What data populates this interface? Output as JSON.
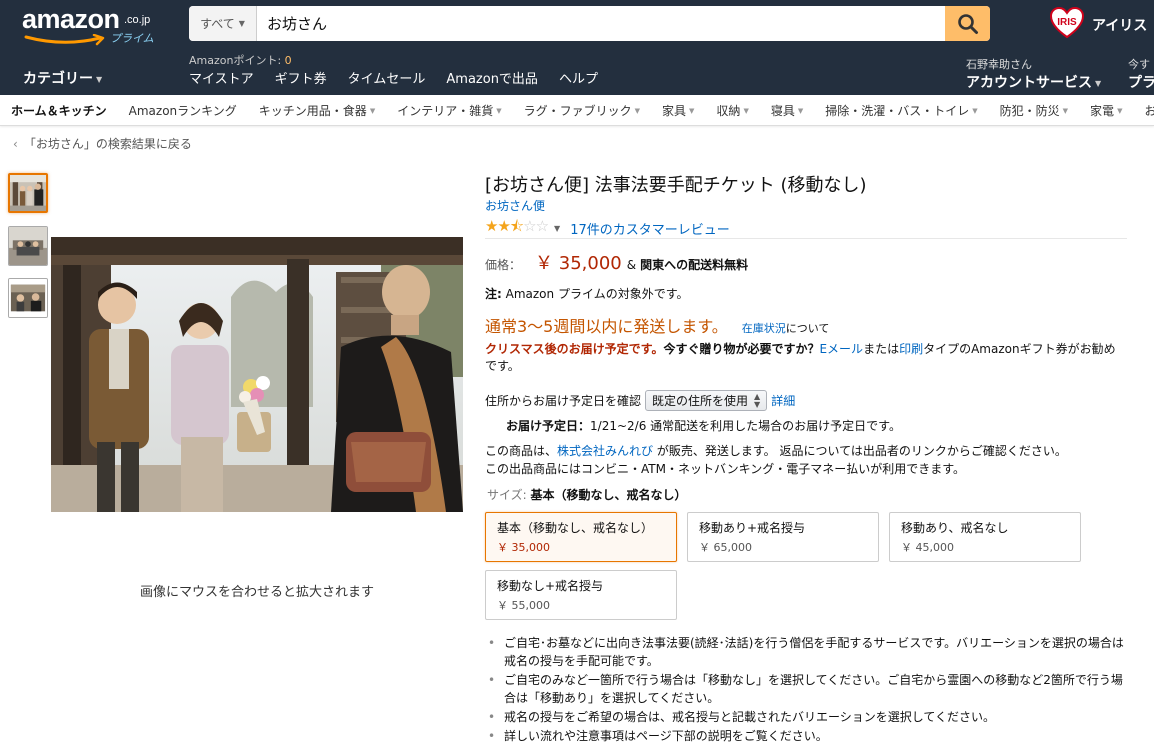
{
  "header": {
    "logo_text": "amazon",
    "logo_tld": ".co.jp",
    "logo_prime": "プライム",
    "search_dept": "すべて",
    "search_query": "お坊さん",
    "promo_text": "アイリス",
    "promo_badge": "IRIS",
    "category_label": "カテゴリー",
    "points_label": "Amazonポイント: ",
    "points_value": "0",
    "nav_links": [
      "マイストア",
      "ギフト券",
      "タイムセール",
      "Amazonで出品",
      "ヘルプ"
    ],
    "account_hello": "石野幸助さん",
    "account_label": "アカウントサービス",
    "prime_hello": "今す",
    "prime_label": "プラ"
  },
  "subnav": {
    "home": "ホーム＆キッチン",
    "items": [
      "Amazonランキング",
      "キッチン用品・食器",
      "インテリア・雑貨",
      "ラグ・ファブリック",
      "家具",
      "収納",
      "寝具",
      "掃除・洗濯・バス・トイレ",
      "防犯・防災",
      "家電",
      "お"
    ]
  },
  "back_link": "「お坊さん」の検索結果に戻る",
  "zoom_hint": "画像にマウスを合わせると拡大されます",
  "product": {
    "title": "[お坊さん便] 法事法要手配チケット (移動なし)",
    "brand": "お坊さん便",
    "rating": 2.5,
    "reviews": "17件のカスタマーレビュー",
    "price_label": "価格：",
    "price": "￥ 35,000",
    "price_amp": "&",
    "shipping": "関東への配送料無料",
    "prime_note_key": "注:",
    "prime_note": " Amazon プライムの対象外です。",
    "availability": "通常3～5週間以内に発送します。",
    "stock_link": "在庫状況",
    "stock_after": "について",
    "xmas_red": "クリスマス後のお届け予定です。",
    "xmas_bold": "今すぐ贈り物が必要ですか？",
    "xmas_link1": "Eメール",
    "xmas_mid": "または",
    "xmas_link2": "印刷",
    "xmas_tail": "タイプのAmazonギフト券がお勧めです。",
    "delivery_check_label": "住所からお届け予定日を確認",
    "delivery_select": "既定の住所を使用",
    "delivery_detail": "詳細",
    "delivery_date_key": "お届け予定日：",
    "delivery_date": "1/21~2/6 通常配送を利用した場合のお届け予定日です。",
    "seller_pre": "この商品は、",
    "seller_link": "株式会社みんれび",
    "seller_post": " が販売、発送します。 返品については出品者のリンクからご確認ください。",
    "payment_note": "この出品商品にはコンビニ・ATM・ネットバンキング・電子マネー払いが利用できます。",
    "size_key": "サイズ: ",
    "size_value": "基本（移動なし、戒名なし）",
    "variants": [
      {
        "name": "基本（移動なし、戒名なし）",
        "price": "￥ 35,000"
      },
      {
        "name": "移動あり+戒名授与",
        "price": "￥ 65,000"
      },
      {
        "name": "移動あり、戒名なし",
        "price": "￥ 45,000"
      },
      {
        "name": "移動なし+戒名授与",
        "price": "￥ 55,000"
      }
    ],
    "bullets": [
      "ご自宅･お墓などに出向き法事法要(読経･法話)を行う僧侶を手配するサービスです。バリエーションを選択の場合は戒名の授与を手配可能です。",
      "ご自宅のみなど一箇所で行う場合は「移動なし」を選択してください。ご自宅から霊園への移動など2箇所で行う場合は「移動あり」を選択してください。",
      "戒名の授与をご希望の場合は、戒名授与と記載されたバリエーションを選択してください。",
      "詳しい流れや注意事項はページ下部の説明をご覧ください。"
    ]
  },
  "colors": {
    "nav_bg": "#232f3e",
    "search_button": "#febd69",
    "price": "#b12704",
    "availability": "#c45500",
    "link": "#0066c0",
    "selected_border": "#e77600",
    "star": "#f4a41c"
  }
}
